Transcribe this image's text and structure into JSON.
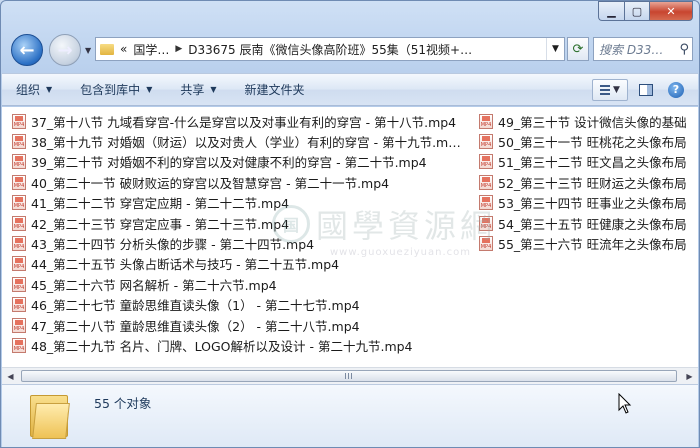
{
  "window": {
    "controls": {
      "minimize": "▁",
      "maximize": "▢",
      "close": "✕"
    }
  },
  "address": {
    "history_caret": "▼",
    "chevrons": "«",
    "crumb1": "国学…",
    "crumb2": "D33675 辰南《微信头像高阶班》55集（51视频+…",
    "dropdown": "▼",
    "refresh_icon": "refresh-icon",
    "search_placeholder": "搜索 D33…"
  },
  "toolbar": {
    "organize": "组织",
    "include_library": "包含到库中",
    "share": "共享",
    "new_folder": "新建文件夹",
    "caret": "▼"
  },
  "files_col1": [
    "37_第十八节 九域看穿宫-什么是穿宫以及对事业有利的穿宫 - 第十八节.mp4",
    "38_第十九节 对婚姻（财运）以及对贵人（学业）有利的穿宫 - 第十九节.m…",
    "39_第二十节 对婚姻不利的穿宫以及对健康不利的穿宫 - 第二十节.mp4",
    "40_第二十一节 破财败运的穿宫以及智慧穿宫 - 第二十一节.mp4",
    "41_第二十二节 穿宫定应期 - 第二十二节.mp4",
    "42_第二十三节 穿宫定应事 - 第二十三节.mp4",
    "43_第二十四节 分析头像的步骤 - 第二十四节.mp4",
    "44_第二十五节 头像占断话术与技巧 - 第二十五节.mp4",
    "45_第二十六节 网名解析 - 第二十六节.mp4",
    "46_第二十七节 童龄思维直读头像（1） - 第二十七节.mp4",
    "47_第二十八节 童龄思维直读头像（2） - 第二十八节.mp4",
    "48_第二十九节 名片、门牌、LOGO解析以及设计 - 第二十九节.mp4"
  ],
  "files_col2": [
    "49_第三十节 设计微信头像的基础",
    "50_第三十一节 旺桃花之头像布局",
    "51_第三十二节 旺文昌之头像布局",
    "52_第三十三节 旺财运之头像布局",
    "53_第三十四节 旺事业之头像布局",
    "54_第三十五节 旺健康之头像布局",
    "55_第三十六节 旺流年之头像布局"
  ],
  "file_icon_label": "MP4",
  "watermark": {
    "seal": "国",
    "text": "國學資源網",
    "url": "www.guoxueziyuan.com"
  },
  "status": {
    "count": "55 个对象"
  }
}
